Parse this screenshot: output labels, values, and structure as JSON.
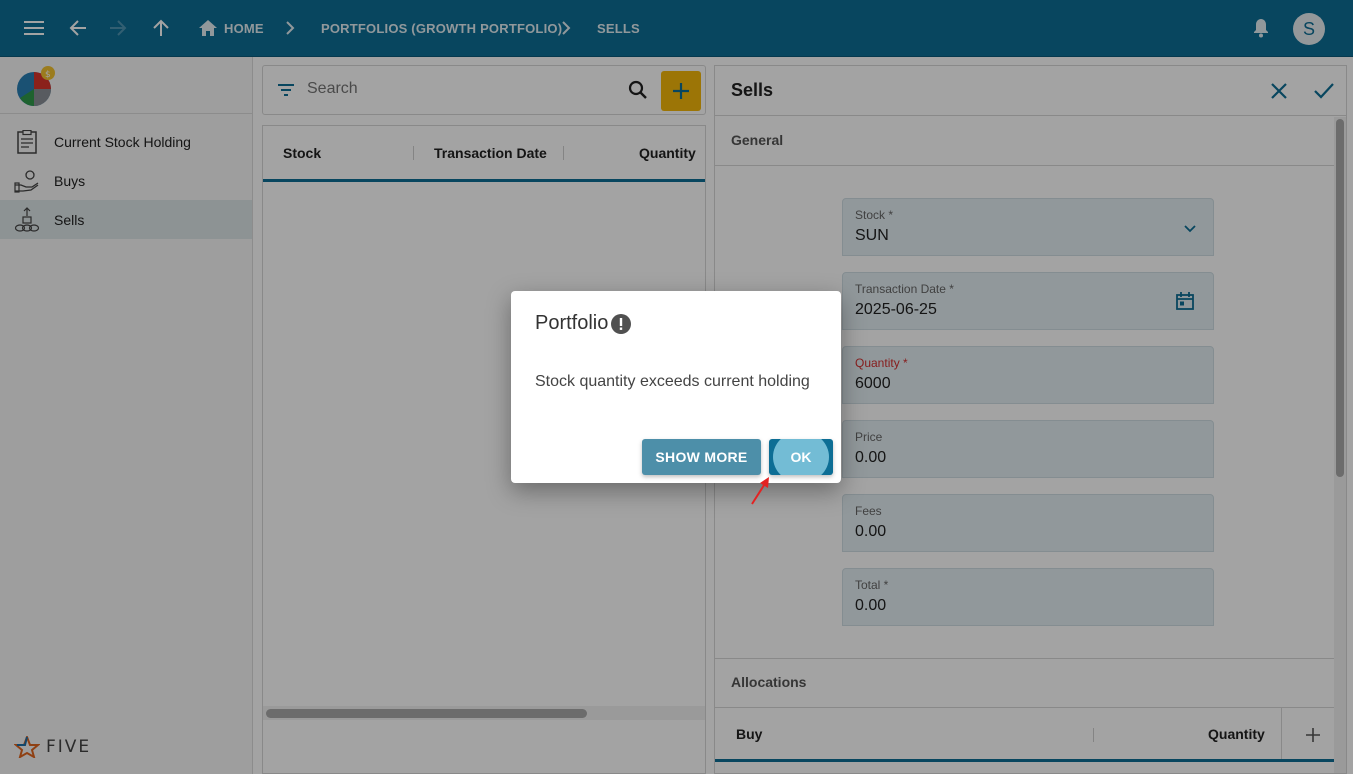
{
  "topbar": {
    "breadcrumbs": [
      "HOME",
      "PORTFOLIOS (GROWTH PORTFOLIO)",
      "SELLS"
    ],
    "avatar_letter": "S",
    "icons": [
      "menu-icon",
      "back-arrow-icon",
      "forward-arrow-icon",
      "up-arrow-icon",
      "home-icon",
      "chevron-right-icon",
      "bell-icon"
    ]
  },
  "sidebar": {
    "items": [
      {
        "label": "Current Stock Holding",
        "icon": "document-chart-icon"
      },
      {
        "label": "Buys",
        "icon": "hand-coin-icon"
      },
      {
        "label": "Sells",
        "icon": "coins-stack-icon",
        "active": true
      }
    ],
    "footer_logo": "FIVE"
  },
  "list": {
    "search_placeholder": "Search",
    "columns": [
      "Stock",
      "Transaction Date",
      "Quantity"
    ]
  },
  "form": {
    "title": "Sells",
    "general_label": "General",
    "fields": [
      {
        "label": "Stock *",
        "value": "SUN"
      },
      {
        "label": "Transaction Date *",
        "value": "2025-06-25"
      },
      {
        "label": "Quantity *",
        "value": "6000"
      },
      {
        "label": "Price",
        "value": "0.00"
      },
      {
        "label": "Fees",
        "value": "0.00"
      },
      {
        "label": "Total *",
        "value": "0.00"
      }
    ],
    "allocations_label": "Allocations",
    "allocations_columns": [
      "Buy",
      "Quantity"
    ]
  },
  "dialog": {
    "title": "Portfolio",
    "message": "Stock quantity exceeds current holding",
    "show_more_label": "SHOW MORE",
    "ok_label": "OK"
  },
  "colors": {
    "primary": "#0d6e95",
    "accent": "#f5b70a",
    "required_label": "#d32f2f"
  }
}
